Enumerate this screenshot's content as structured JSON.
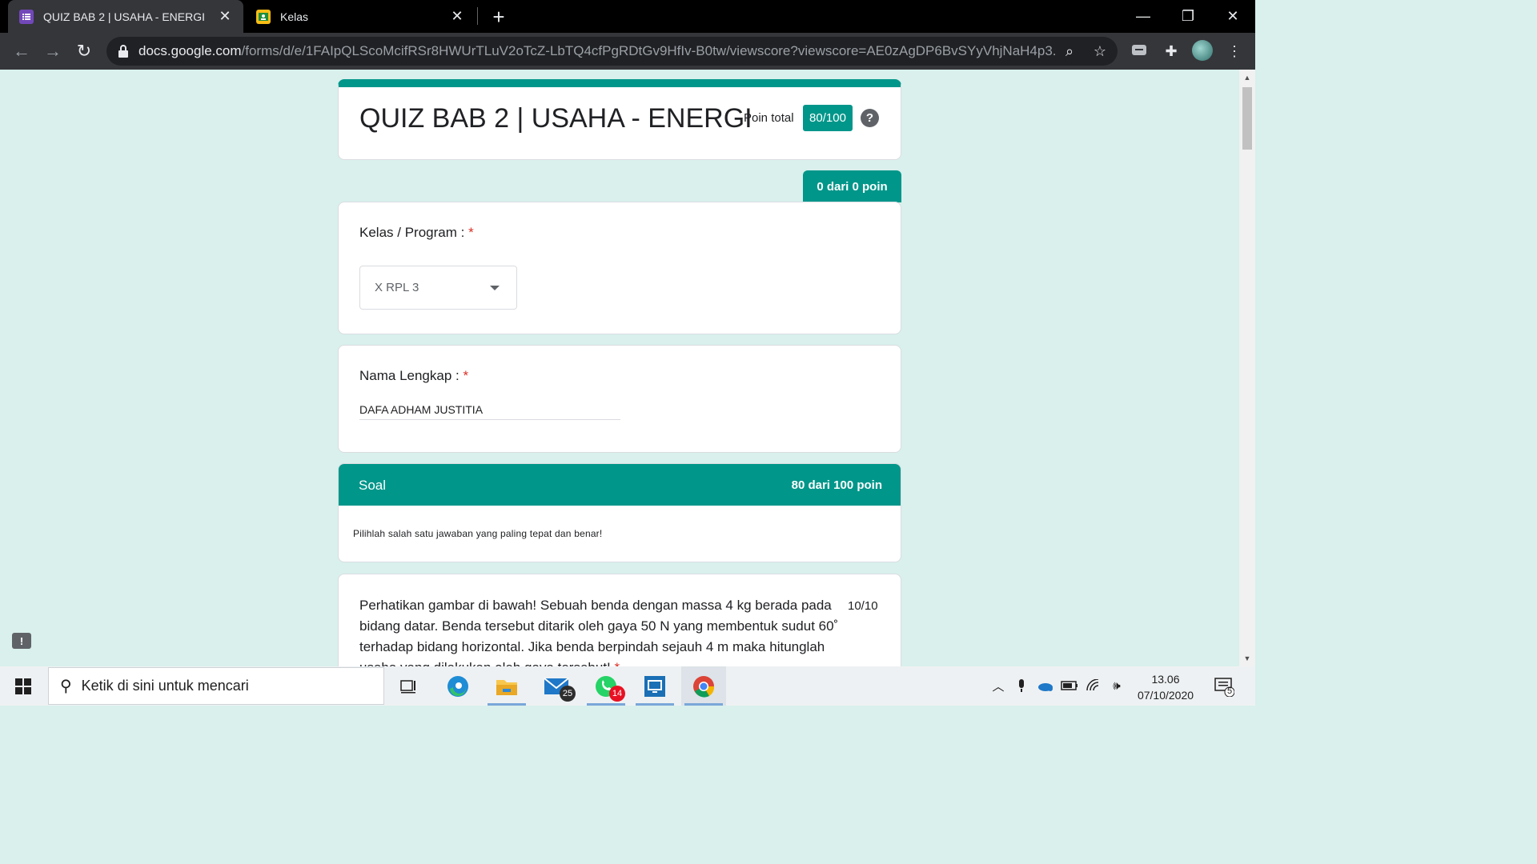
{
  "browser": {
    "tabs": [
      {
        "title": "QUIZ BAB 2 | USAHA - ENERGI",
        "active": true,
        "icon": "forms-icon"
      },
      {
        "title": "Kelas",
        "active": false,
        "icon": "classroom-icon"
      }
    ],
    "url_host": "docs.google.com",
    "url_path": "/forms/d/e/1FAIpQLScoMcifRSr8HWUrTLuV2oTcZ-LbTQ4cfPgRDtGv9HfIv-B0tw/viewscore?viewscore=AE0zAgDP6BvSYyVhjNaH4p3..."
  },
  "form": {
    "title": "QUIZ BAB 2 | USAHA - ENERGI",
    "poin_total_label": "Poin total",
    "score": "80/100",
    "help_icon": "?"
  },
  "section1": {
    "points": "0 dari 0 poin"
  },
  "questions": {
    "kelas": {
      "label": "Kelas / Program :",
      "required": "*",
      "value": "X RPL 3"
    },
    "nama": {
      "label": "Nama Lengkap :",
      "required": "*",
      "value": "DAFA ADHAM JUSTITIA"
    }
  },
  "section2": {
    "title": "Soal",
    "points": "80 dari 100 poin",
    "description": "Pilihlah salah satu jawaban yang paling tepat dan benar!"
  },
  "question1": {
    "text": "Perhatikan gambar di bawah! Sebuah benda dengan massa 4 kg berada pada bidang datar. Benda tersebut ditarik oleh gaya 50 N yang membentuk sudut 60˚ terhadap bidang horizontal. Jika benda berpindah sejauh 4 m maka hitunglah usaha yang dilakukan oleh gaya tersebut!",
    "required": "*",
    "score": "10/10"
  },
  "taskbar": {
    "search_placeholder": "Ketik di sini untuk mencari",
    "mail_badge": "25",
    "whatsapp_badge": "14",
    "time": "13.06",
    "date": "07/10/2020",
    "notification_count": "5"
  },
  "colors": {
    "accent": "#00968a",
    "page_bg": "#d9f0ec",
    "required": "#d93025"
  }
}
